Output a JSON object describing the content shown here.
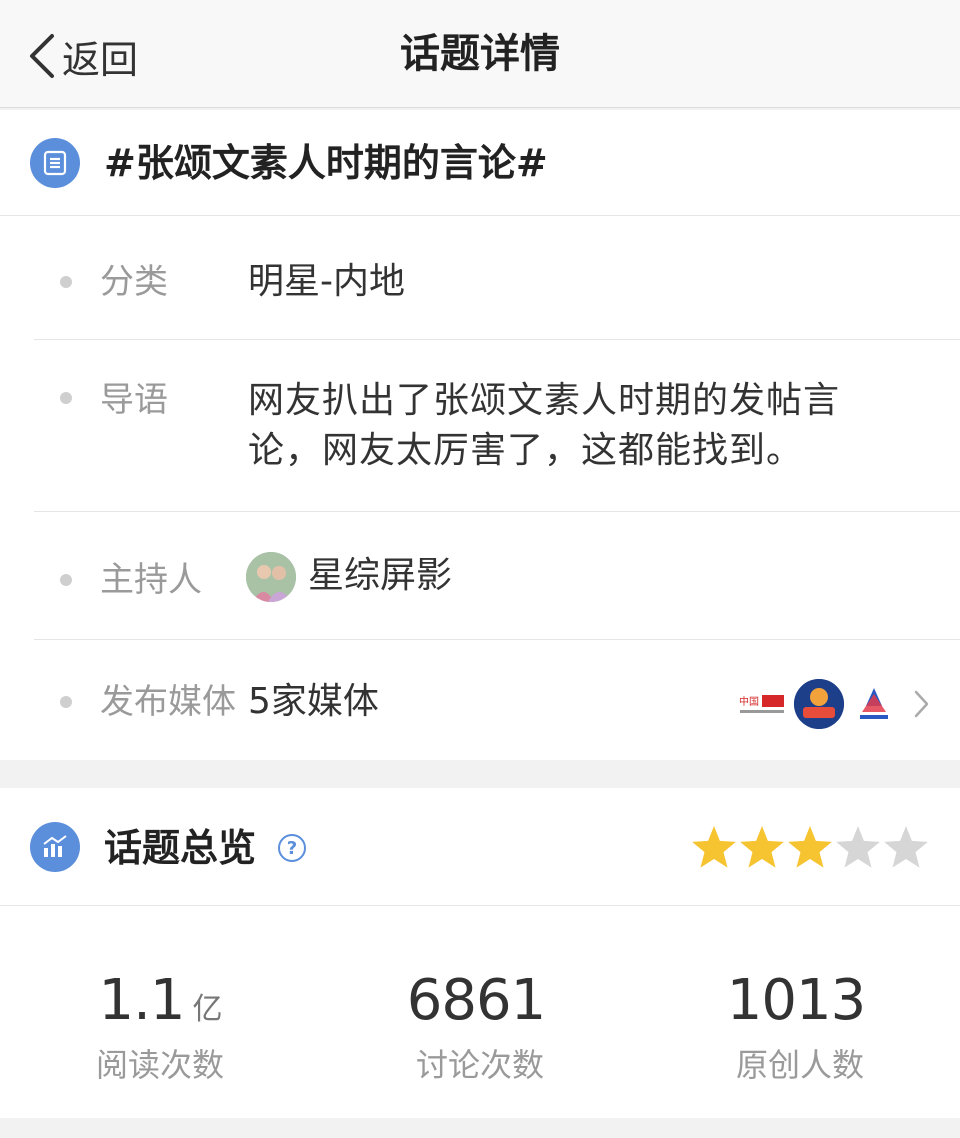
{
  "navbar": {
    "back_label": "返回",
    "title": "话题详情"
  },
  "topic": {
    "title": "#张颂文素人时期的言论#",
    "icon": "list-icon"
  },
  "details": {
    "category": {
      "label": "分类",
      "value": "明星-内地"
    },
    "guide": {
      "label": "导语",
      "value": "网友扒出了张颂文素人时期的发帖言论，网友太厉害了，这都能找到。"
    },
    "host": {
      "label": "主持人",
      "value": "星综屏影",
      "avatar": "host-avatar"
    },
    "media": {
      "label": "发布媒体",
      "value": "5家媒体",
      "logos": [
        "china-ent-logo",
        "media-badge-logo",
        "eastern-music-logo"
      ]
    }
  },
  "overview": {
    "title": "话题总览",
    "help_icon": "help-icon",
    "rating": 3,
    "rating_max": 5,
    "star_color_on": "#f7c431",
    "star_color_off": "#d6d6d6",
    "stats": [
      {
        "value": "1.1",
        "unit": "亿",
        "label": "阅读次数"
      },
      {
        "value": "6861",
        "unit": "",
        "label": "讨论次数"
      },
      {
        "value": "1013",
        "unit": "",
        "label": "原创人数"
      }
    ]
  },
  "colors": {
    "accent": "#5b8fdc",
    "page_bg": "#f2f2f2"
  }
}
